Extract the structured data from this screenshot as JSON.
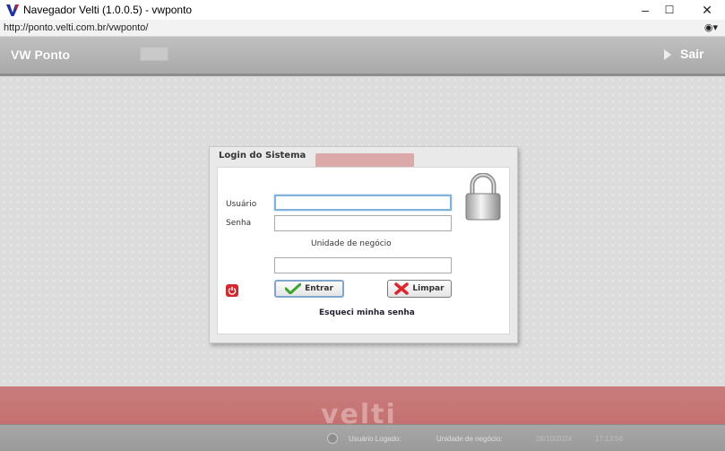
{
  "window": {
    "title": "Navegador Velti (1.0.0.5) - vwponto",
    "minimize": "–",
    "maximize": "☐",
    "close": "✕"
  },
  "address": {
    "url": "http://ponto.velti.com.br/vwponto/",
    "menu": "◉▾"
  },
  "header": {
    "title": "VW Ponto",
    "exit_label": "Sair"
  },
  "login": {
    "panel_title": "Login do Sistema",
    "user_label": "Usuário",
    "password_label": "Senha",
    "unit_label": "Unidade de negócio",
    "user_value": "",
    "password_value": "",
    "unit_value": "",
    "enter_label": "Entrar",
    "clear_label": "Limpar",
    "forgot_label": "Esqueci minha senha"
  },
  "footer": {
    "brand": "velti",
    "logged_user_label": "Usuário Logado:",
    "unit_label": "Unidade de negócio:",
    "date": "28/10/2024",
    "time": "17:13:56"
  },
  "colors": {
    "header": "#aaaaaa",
    "footer_red": "#c57070",
    "focus_border": "#7fb2dc",
    "power": "#d7262b"
  }
}
